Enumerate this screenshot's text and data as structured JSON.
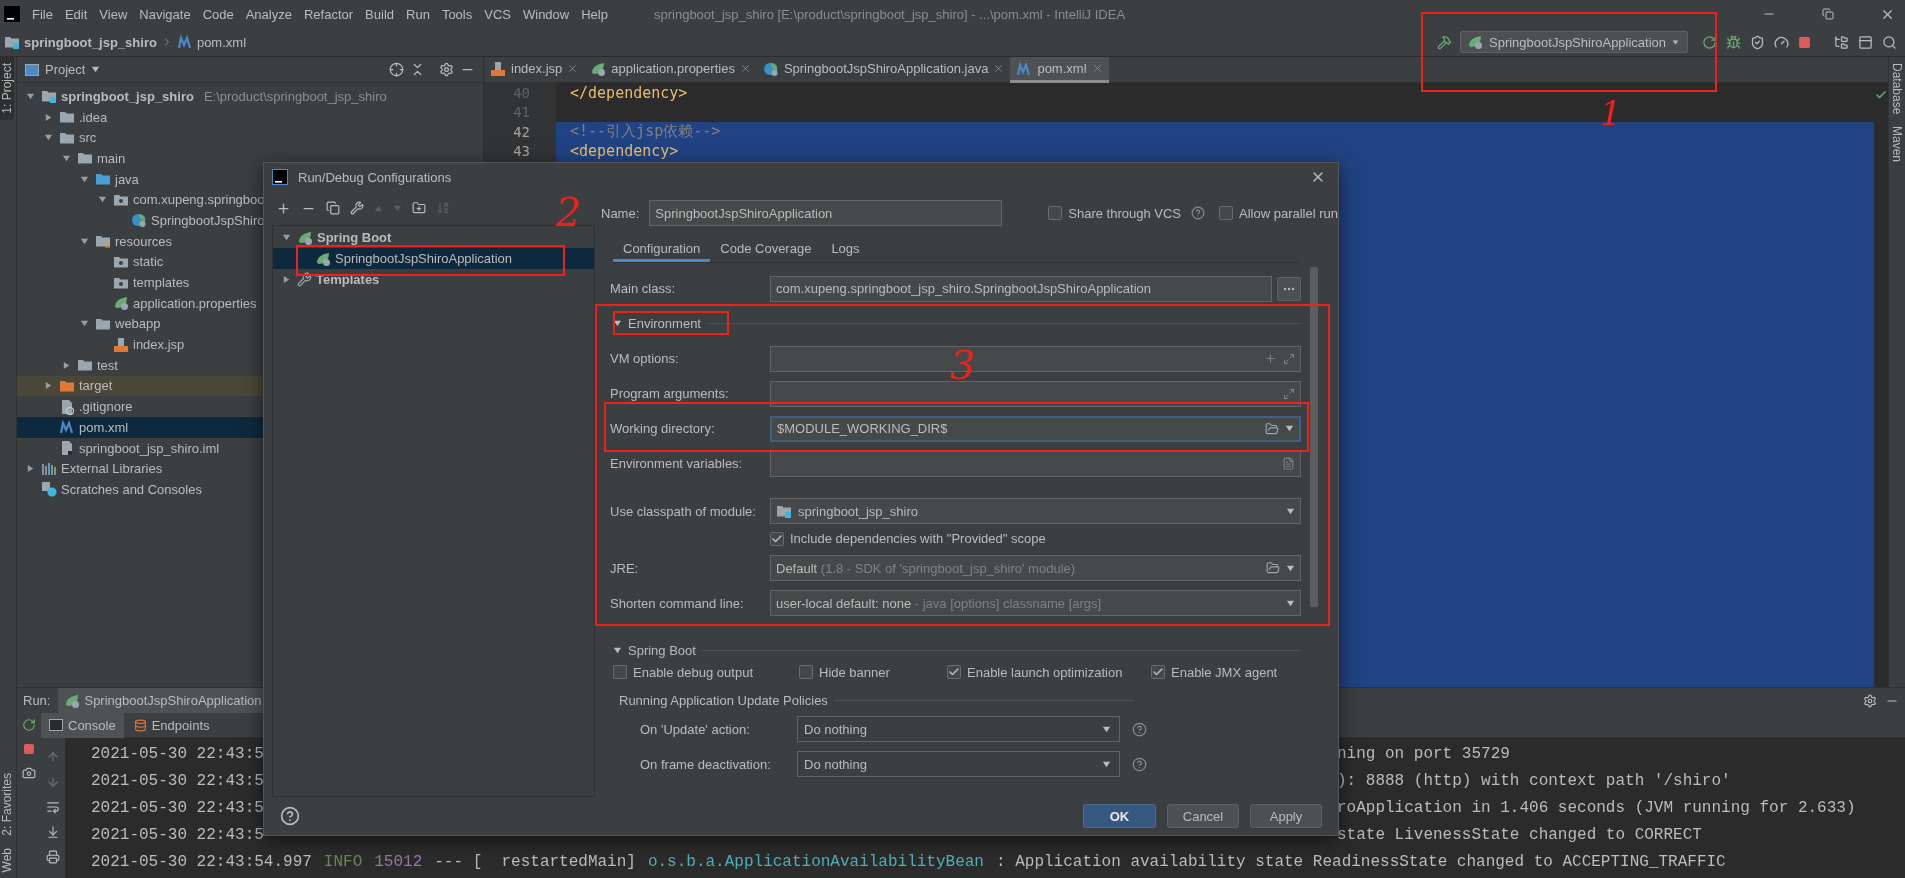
{
  "menu_bar": {
    "items": [
      "File",
      "Edit",
      "View",
      "Navigate",
      "Code",
      "Analyze",
      "Refactor",
      "Build",
      "Run",
      "Tools",
      "VCS",
      "Window",
      "Help"
    ],
    "title": "springboot_jsp_shiro [E:\\product\\springboot_jsp_shiro] - ...\\pom.xml - IntelliJ IDEA"
  },
  "nav_bar": {
    "crumbs": [
      {
        "label": "springboot_jsp_shiro",
        "kind": "module"
      },
      {
        "label": "pom.xml",
        "kind": "maven"
      }
    ],
    "run_config": "SpringbootJspShiroApplication"
  },
  "left_strip": {
    "tabs": [
      {
        "label": "1: Project",
        "selected": true
      }
    ],
    "bottom_tabs": [
      {
        "label": "2: Favorites",
        "selected": false
      },
      {
        "label": "Web",
        "selected": false
      }
    ]
  },
  "project": {
    "title": "Project",
    "tree": [
      {
        "name": "springboot_jsp_shiro",
        "path": "E:\\product\\springboot_jsp_shiro",
        "kind": "module",
        "expanded": true,
        "selected": false,
        "children": [
          {
            "name": ".idea",
            "kind": "folder",
            "expanded": false,
            "selected": false
          },
          {
            "name": "src",
            "kind": "folder",
            "expanded": true,
            "selected": false,
            "children": [
              {
                "name": "main",
                "kind": "folder",
                "expanded": true,
                "selected": false,
                "children": [
                  {
                    "name": "java",
                    "kind": "source",
                    "expanded": true,
                    "selected": false,
                    "children": [
                      {
                        "name": "com.xupeng.springboo",
                        "kind": "package",
                        "expanded": true,
                        "selected": false,
                        "children": [
                          {
                            "name": "SpringbootJspShiro",
                            "kind": "spring-class",
                            "selected": false
                          }
                        ]
                      }
                    ]
                  },
                  {
                    "name": "resources",
                    "kind": "resources",
                    "expanded": true,
                    "selected": false,
                    "children": [
                      {
                        "name": "static",
                        "kind": "package",
                        "selected": false
                      },
                      {
                        "name": "templates",
                        "kind": "package",
                        "selected": false
                      },
                      {
                        "name": "application.properties",
                        "kind": "spring-file",
                        "selected": false
                      }
                    ]
                  },
                  {
                    "name": "webapp",
                    "kind": "folder",
                    "expanded": true,
                    "selected": false,
                    "children": [
                      {
                        "name": "index.jsp",
                        "kind": "jsp",
                        "selected": false
                      }
                    ]
                  }
                ]
              },
              {
                "name": "test",
                "kind": "folder",
                "expanded": false,
                "selected": false
              }
            ]
          },
          {
            "name": "target",
            "kind": "excluded",
            "expanded": false,
            "selected": false
          },
          {
            "name": ".gitignore",
            "kind": "ignore",
            "selected": false
          },
          {
            "name": "pom.xml",
            "kind": "maven",
            "selected": true
          },
          {
            "name": "springboot_jsp_shiro.iml",
            "kind": "iml",
            "selected": false
          }
        ]
      },
      {
        "name": "External Libraries",
        "kind": "libraries",
        "expanded": false,
        "selected": false
      },
      {
        "name": "Scratches and Consoles",
        "kind": "scratches",
        "selected": false
      }
    ]
  },
  "editor": {
    "tabs": [
      {
        "label": "index.jsp",
        "kind": "jsp",
        "selected": false
      },
      {
        "label": "application.properties",
        "kind": "spring-file",
        "selected": false
      },
      {
        "label": "SpringbootJspShiroApplication.java",
        "kind": "spring-class",
        "selected": false
      },
      {
        "label": "pom.xml",
        "kind": "maven",
        "selected": true
      }
    ],
    "lines": [
      {
        "number": "40",
        "text": "</dependency>",
        "kind": "tag",
        "selected": false
      },
      {
        "number": "41",
        "selected": false
      },
      {
        "number": "42",
        "text": "<!--引入jsp依赖-->",
        "kind": "comment",
        "selected": true
      },
      {
        "number": "43",
        "text": "<dependency>",
        "kind": "tag",
        "selected": true
      }
    ]
  },
  "right_strip": {
    "tabs": [
      "Database",
      "Maven"
    ]
  },
  "run": {
    "label": "Run:",
    "config_tab": "SpringbootJspShiroApplication",
    "tabs": [
      {
        "label": "Console",
        "selected": true
      },
      {
        "label": "Endpoints",
        "selected": false
      }
    ],
    "lines": [
      {
        "left": "2021-05-30 22:43:5",
        "right": "ning on port 35729"
      },
      {
        "left": "2021-05-30 22:43:5",
        "right": "): 8888 (http) with context path '/shiro'"
      },
      {
        "left": "2021-05-30 22:43:5",
        "right": "roApplication in 1.406 seconds (JVM running for 2.633)"
      },
      {
        "left": "2021-05-30 22:43:5",
        "right": "state LivenessState changed to CORRECT"
      },
      {
        "segments": [
          {
            "text": "2021-05-30 22:43:54.997",
            "kind": "plain"
          },
          {
            "text": "INFO",
            "kind": "level"
          },
          {
            "text": "15012",
            "kind": "pid"
          },
          {
            "text": "--- [  restartedMain]",
            "kind": "plain"
          },
          {
            "text": "o.s.b.a.ApplicationAvailabilityBean",
            "kind": "logger"
          },
          {
            "text": ": Application availability state ReadinessState changed to ACCEPTING_TRAFFIC",
            "kind": "plain"
          }
        ]
      }
    ]
  },
  "dialog": {
    "title": "Run/Debug Configurations",
    "configs": [
      {
        "name": "Spring Boot",
        "kind": "group",
        "expanded": true,
        "selected": false,
        "children": [
          {
            "name": "SpringbootJspShiroApplication",
            "kind": "config",
            "selected": true
          }
        ]
      },
      {
        "name": "Templates",
        "kind": "templates",
        "expanded": false,
        "selected": false
      }
    ],
    "name": {
      "label": "Name:",
      "value": "SpringbootJspShiroApplication"
    },
    "share": {
      "label": "Share through VCS",
      "checked": false
    },
    "parallel": {
      "label": "Allow parallel run",
      "checked": false
    },
    "tabs": [
      {
        "label": "Configuration",
        "selected": true
      },
      {
        "label": "Code Coverage",
        "selected": false
      },
      {
        "label": "Logs",
        "selected": false
      }
    ],
    "main_class": {
      "label": "Main class:",
      "value": "com.xupeng.springboot_jsp_shiro.SpringbootJspShiroApplication"
    },
    "environment": {
      "title": "Environment",
      "expanded": true,
      "fields": [
        {
          "label": "VM options:",
          "kind": "options"
        },
        {
          "label": "Program arguments:",
          "kind": "arguments"
        },
        {
          "label": "Working directory:",
          "kind": "path",
          "value": "$MODULE_WORKING_DIR$",
          "focused": true
        },
        {
          "label": "Environment variables:",
          "kind": "variables"
        },
        {
          "label": "Use classpath of module:",
          "kind": "module",
          "value": "springboot_jsp_shiro"
        },
        {
          "label": "Include dependencies with \"Provided\" scope",
          "kind": "checkbox",
          "checked": true
        },
        {
          "label": "JRE:",
          "kind": "jre",
          "value": "Default",
          "hint": "(1.8 - SDK of 'springboot_jsp_shiro' module)"
        },
        {
          "label": "Shorten command line:",
          "kind": "combo",
          "value": "user-local default: none",
          "hint": "- java [options] classname [args]"
        }
      ]
    },
    "spring_boot": {
      "title": "Spring Boot",
      "expanded": true,
      "options": [
        {
          "label": "Enable debug output",
          "checked": false
        },
        {
          "label": "Hide banner",
          "checked": false
        },
        {
          "label": "Enable launch optimization",
          "checked": true
        },
        {
          "label": "Enable JMX agent",
          "checked": true
        }
      ],
      "policies": {
        "title": "Running Application Update Policies",
        "rows": [
          {
            "label": "On 'Update' action:",
            "value": "Do nothing"
          },
          {
            "label": "On frame deactivation:",
            "value": "Do nothing"
          }
        ]
      }
    },
    "buttons": [
      {
        "label": "OK",
        "kind": "primary"
      },
      {
        "label": "Cancel",
        "kind": "normal"
      },
      {
        "label": "Apply",
        "kind": "normal"
      }
    ]
  },
  "annotations": [
    {
      "kind": "box"
    },
    {
      "kind": "mark",
      "text": "1"
    },
    {
      "kind": "box"
    },
    {
      "kind": "mark",
      "text": "2"
    },
    {
      "kind": "box"
    },
    {
      "kind": "box"
    },
    {
      "kind": "box"
    },
    {
      "kind": "mark",
      "text": "3"
    }
  ]
}
